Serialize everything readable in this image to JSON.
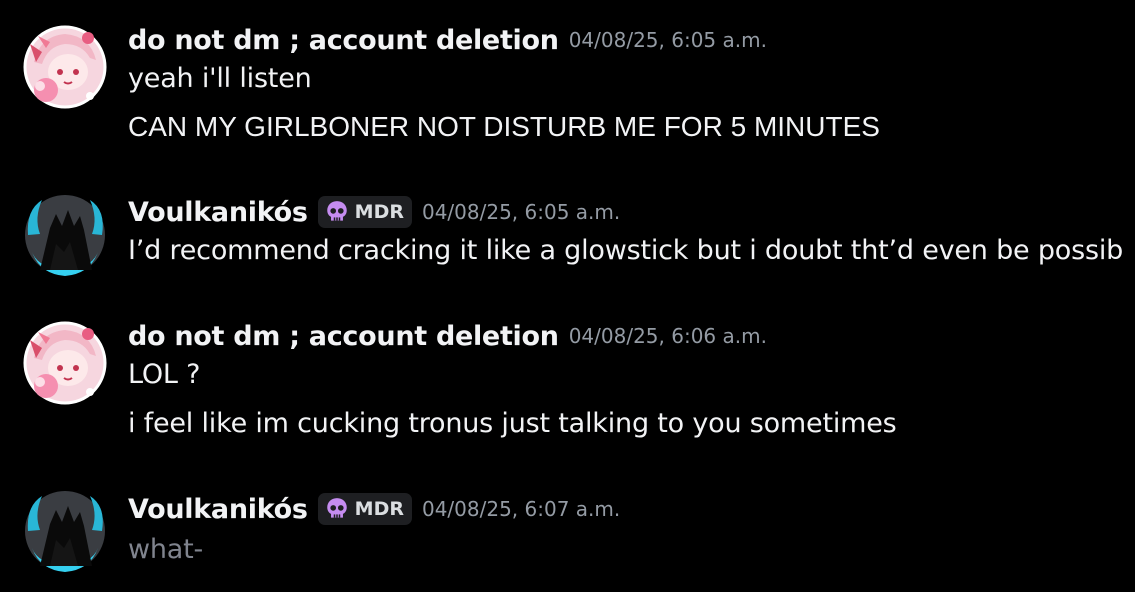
{
  "colors": {
    "background": "#000000",
    "text": "#f2f3f5",
    "timestamp": "#949ba4",
    "muted_text": "#80848e",
    "tag_background": "#1e1f22",
    "tag_icon": "#c58cf0"
  },
  "messages": [
    {
      "username": "do not dm ; account deletion",
      "timestamp": "04/08/25, 6:05 a.m.",
      "avatar": "pink-anime-avatar",
      "lines": [
        "yeah i'll listen",
        "CAN MY GIRLBONER NOT DISTURB ME FOR 5 MINUTES"
      ]
    },
    {
      "username": "Voulkanikós",
      "tag": {
        "icon": "skull-icon",
        "label": "MDR"
      },
      "timestamp": "04/08/25, 6:05 a.m.",
      "avatar": "dark-silhouette-avatar",
      "lines": [
        "I’d recommend cracking it like a glowstick but i doubt tht’d even be possib"
      ]
    },
    {
      "username": "do not dm ; account deletion",
      "timestamp": "04/08/25, 6:06 a.m.",
      "avatar": "pink-anime-avatar",
      "lines": [
        "LOL ?",
        "i feel like im cucking tronus just talking to you sometimes"
      ]
    },
    {
      "username": "Voulkanikós",
      "tag": {
        "icon": "skull-icon",
        "label": "MDR"
      },
      "timestamp": "04/08/25, 6:07 a.m.",
      "avatar": "dark-silhouette-avatar",
      "lines": [
        "what-"
      ]
    }
  ]
}
